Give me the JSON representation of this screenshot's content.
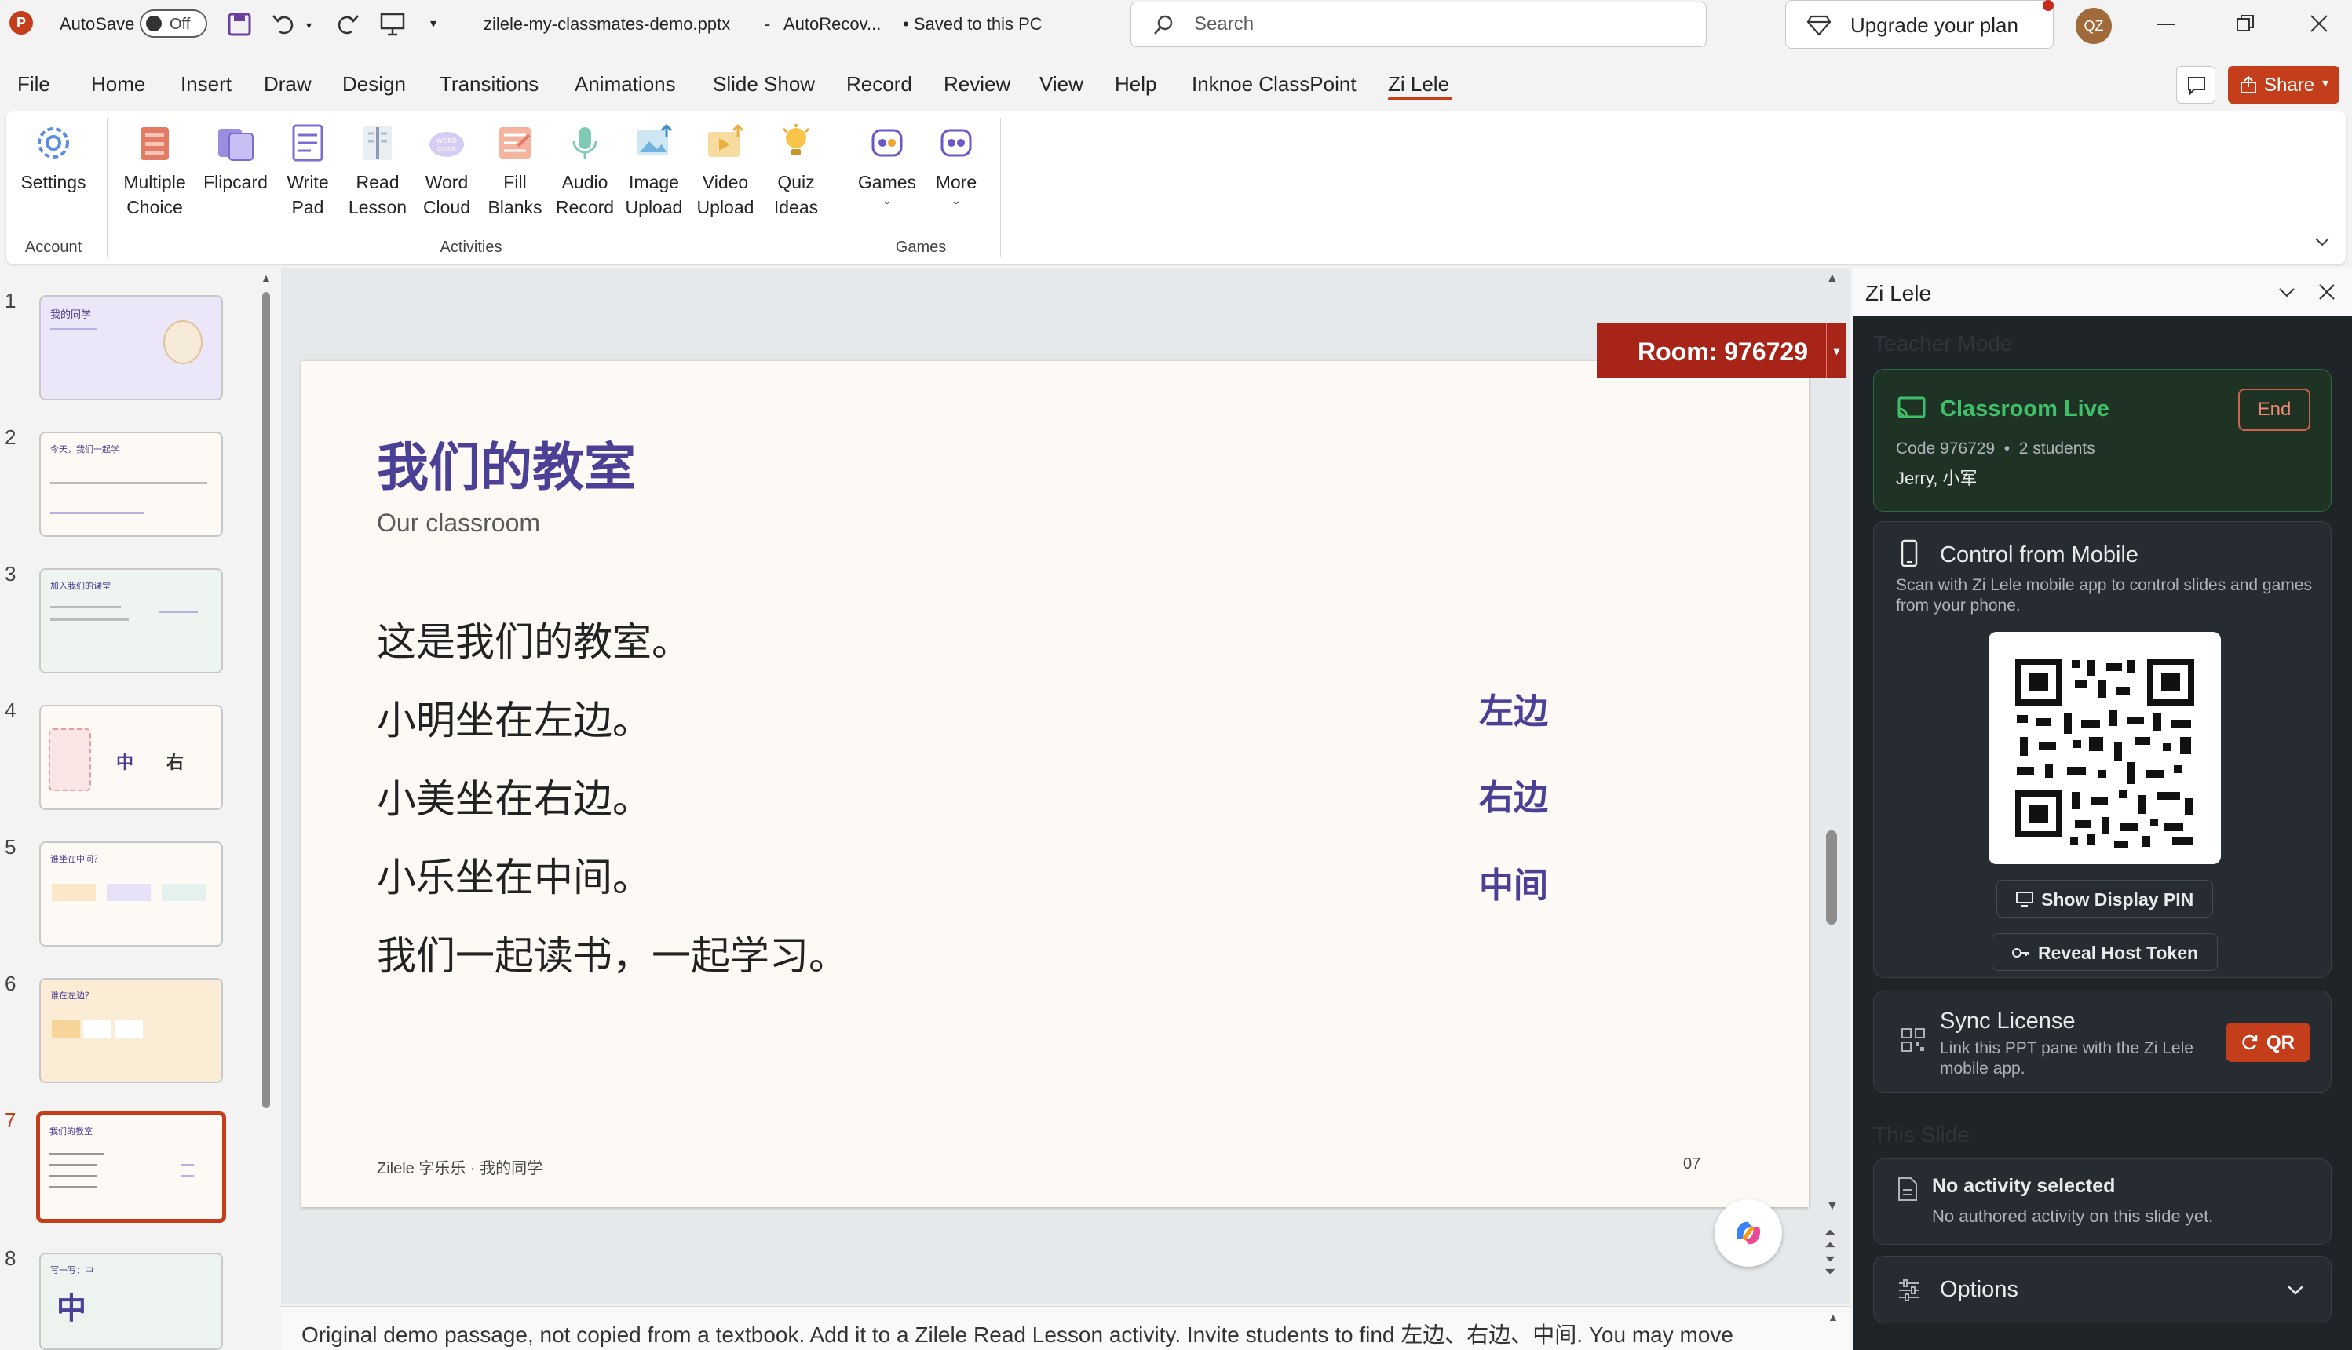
{
  "titlebar": {
    "autosave_label": "AutoSave",
    "autosave_state": "Off",
    "file_name": "zilele-my-classmates-demo.pptx",
    "separator": "-",
    "status": "AutoRecov...",
    "saved": "• Saved to this PC",
    "search_placeholder": "Search",
    "upgrade_label": "Upgrade your plan",
    "avatar_initials": "QZ"
  },
  "menu": {
    "tabs": [
      "File",
      "Home",
      "Insert",
      "Draw",
      "Design",
      "Transitions",
      "Animations",
      "Slide Show",
      "Record",
      "Review",
      "View",
      "Help",
      "Inknoe ClassPoint",
      "Zi Lele"
    ],
    "active": "Zi Lele",
    "share_label": "Share"
  },
  "ribbon": {
    "buttons": [
      {
        "label": "Settings",
        "icon": "settings-icon"
      },
      {
        "label": "Multiple\nChoice",
        "icon": "multiple-choice-icon"
      },
      {
        "label": "Flipcard",
        "icon": "flipcard-icon"
      },
      {
        "label": "Write\nPad",
        "icon": "write-pad-icon"
      },
      {
        "label": "Read\nLesson",
        "icon": "read-lesson-icon"
      },
      {
        "label": "Word\nCloud",
        "icon": "word-cloud-icon"
      },
      {
        "label": "Fill\nBlanks",
        "icon": "fill-blanks-icon"
      },
      {
        "label": "Audio\nRecord",
        "icon": "audio-record-icon"
      },
      {
        "label": "Image\nUpload",
        "icon": "image-upload-icon"
      },
      {
        "label": "Video\nUpload",
        "icon": "video-upload-icon"
      },
      {
        "label": "Quiz\nIdeas",
        "icon": "quiz-ideas-icon"
      },
      {
        "label": "Games",
        "icon": "games-icon"
      },
      {
        "label": "More",
        "icon": "more-icon"
      }
    ],
    "groups": [
      "Account",
      "Activities",
      "Games"
    ]
  },
  "thumbnails": {
    "numbers": [
      "1",
      "2",
      "3",
      "4",
      "5",
      "6",
      "7",
      "8"
    ],
    "selected": "7"
  },
  "slide": {
    "title": "我们的教室",
    "subtitle": "Our classroom",
    "lines": [
      "这是我们的教室。",
      "小明坐在左边。",
      "小美坐在右边。",
      "小乐坐在中间。",
      "我们一起读书，一起学习。"
    ],
    "words": [
      "左边",
      "右边",
      "中间"
    ],
    "footer_left": "Zilele 字乐乐 · 我的同学",
    "footer_right": "07"
  },
  "room_badge": "Room: 976729",
  "notes_text": "Original demo passage, not copied from a textbook. Add it to a Zilele Read Lesson activity. Invite students to find 左边、右边、中间. You may move",
  "panel": {
    "title": "Zi Lele",
    "teacher_mode": "Teacher Mode",
    "live": {
      "title": "Classroom Live",
      "end_label": "End",
      "code_line": "Code 976729  •  2 students",
      "students": "Jerry, 小军"
    },
    "mobile": {
      "title": "Control from Mobile",
      "desc": "Scan with Zi Lele mobile app to control slides and games from your phone.",
      "show_pin": "Show Display PIN",
      "reveal_token": "Reveal Host Token"
    },
    "sync": {
      "title": "Sync License",
      "desc": "Link this PPT pane with the Zi Lele mobile app.",
      "qr_label": "QR"
    },
    "this_slide": "This Slide",
    "activity": {
      "title": "No activity selected",
      "desc": "No authored activity on this slide yet."
    },
    "options_label": "Options"
  },
  "colors": {
    "accent": "#c43e1c",
    "slide_purple": "#4b3f96",
    "panel_bg": "#1f2428",
    "live_green": "#3fbf6a"
  }
}
